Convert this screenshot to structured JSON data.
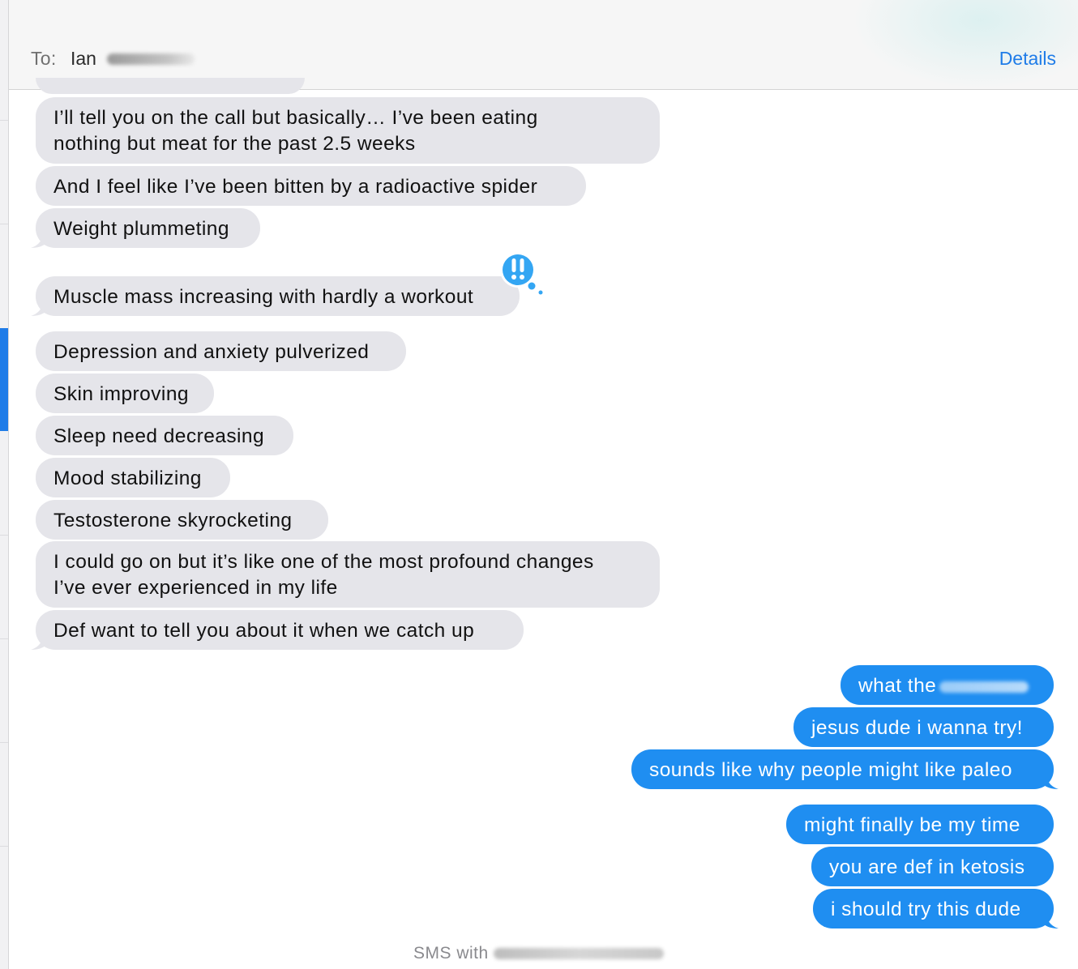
{
  "header": {
    "to_label": "To:",
    "recipient": "Ian",
    "details_label": "Details"
  },
  "incoming": [
    {
      "text": "I’ll tell you on the call but basically… I’ve been eating",
      "text2": "nothing but meat for the past 2.5 weeks"
    },
    {
      "text": "And I feel like I’ve been bitten by a radioactive spider"
    },
    {
      "text": "Weight plummeting"
    },
    {
      "text": "Muscle mass increasing with hardly a workout",
      "tapback": "!!"
    },
    {
      "text": "Depression and anxiety pulverized"
    },
    {
      "text": "Skin improving"
    },
    {
      "text": "Sleep need decreasing"
    },
    {
      "text": "Mood stabilizing"
    },
    {
      "text": "Testosterone skyrocketing"
    },
    {
      "text": "I could go on but it’s like one of the most profound changes",
      "text2": "I’ve ever experienced in my life"
    },
    {
      "text": "Def want to tell you about it when we catch up"
    }
  ],
  "outgoing": [
    {
      "text": "what the"
    },
    {
      "text": "jesus dude i wanna try!"
    },
    {
      "text": "sounds like why people might like paleo"
    },
    {
      "text": "might finally be my time"
    },
    {
      "text": "you are def in ketosis"
    },
    {
      "text": "i should try this dude"
    }
  ],
  "footer": {
    "label": "SMS with"
  },
  "colors": {
    "incoming_bubble": "#e5e5ea",
    "outgoing_bubble": "#1f8ef1",
    "accent": "#1f7ce8",
    "tapback": "#34a6f3"
  },
  "icons": {
    "tapback": "double-exclamation-icon"
  }
}
